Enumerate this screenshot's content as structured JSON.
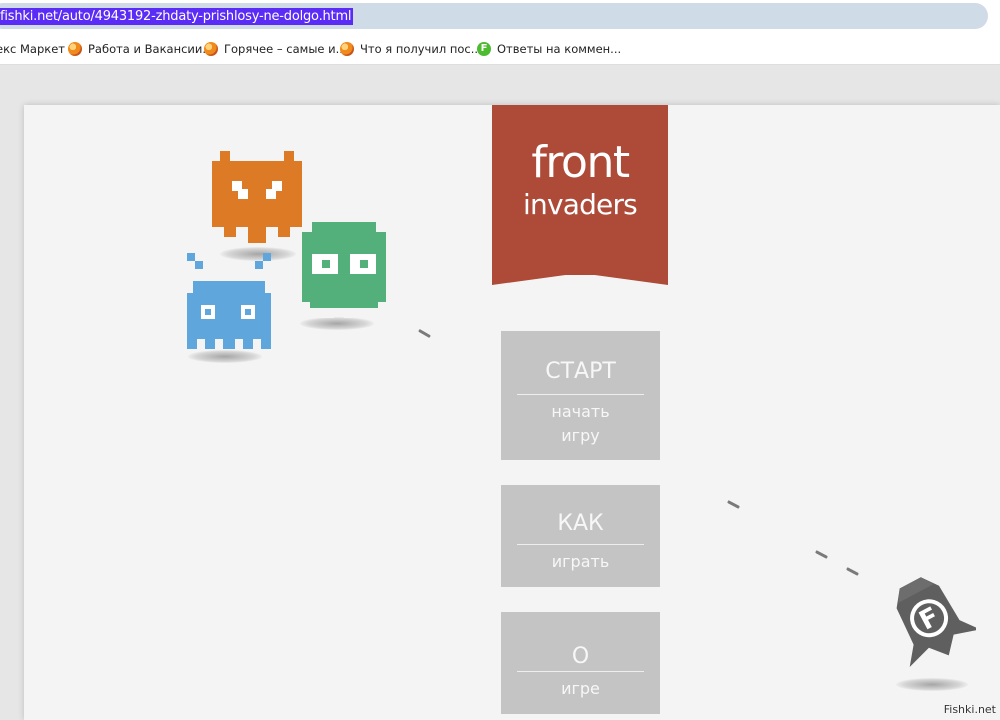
{
  "browser": {
    "url": "fishki.net/auto/4943192-zhdaty-prishlosy-ne-dolgo.html",
    "bookmarks": [
      {
        "label": "екс Маркет",
        "icon": "none"
      },
      {
        "label": "Работа и Вакансии...",
        "icon": "orange-ball-icon"
      },
      {
        "label": "Горячее – самые и...",
        "icon": "orange-ball-icon"
      },
      {
        "label": "Что я получил пос...",
        "icon": "orange-ball-icon"
      },
      {
        "label": "Ответы на коммен...",
        "icon": "green-f-icon",
        "icon_text": "F"
      }
    ]
  },
  "game": {
    "logo": {
      "line1": "front",
      "line2": "invaders",
      "color": "#ad4a38"
    },
    "menu": [
      {
        "title": "СТАРТ",
        "subtitle_lines": [
          "начать",
          "игру"
        ]
      },
      {
        "title": "КАК",
        "subtitle_lines": [
          "играть"
        ]
      },
      {
        "title": "О",
        "subtitle_lines": [
          "игре"
        ]
      }
    ],
    "invaders": [
      {
        "name": "orange-invader",
        "color": "#dd7a26"
      },
      {
        "name": "green-invader",
        "color": "#53b07a"
      },
      {
        "name": "blue-invader",
        "color": "#5fa6dc"
      }
    ],
    "ship": {
      "name": "player-ship",
      "badge": "F",
      "color": "#5f5f5f"
    }
  },
  "watermark": "Fishki.net"
}
